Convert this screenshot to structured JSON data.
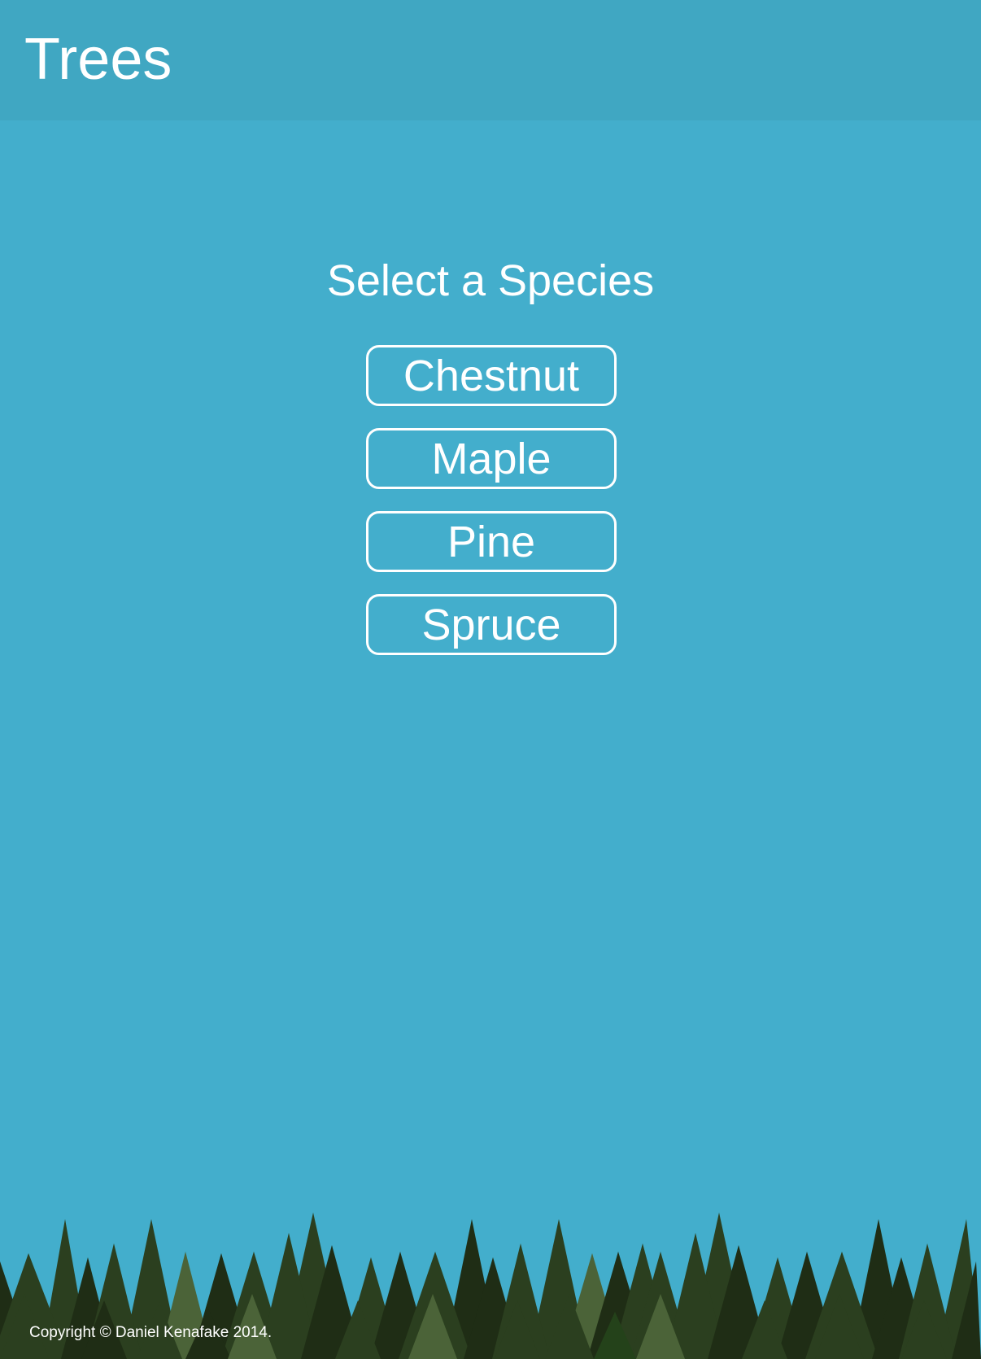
{
  "header": {
    "title": "Trees"
  },
  "main": {
    "heading": "Select a Species",
    "species": [
      {
        "label": "Chestnut"
      },
      {
        "label": "Maple"
      },
      {
        "label": "Pine"
      },
      {
        "label": "Spruce"
      }
    ]
  },
  "footer": {
    "copyright": "Copyright © Daniel Kenafake 2014."
  },
  "colors": {
    "background": "#43aecc",
    "header": "#40a7c2",
    "text": "#ffffff",
    "tree_dark": "#1f2d15",
    "tree_mid": "#2b3f1f",
    "tree_light": "#4b6338"
  }
}
